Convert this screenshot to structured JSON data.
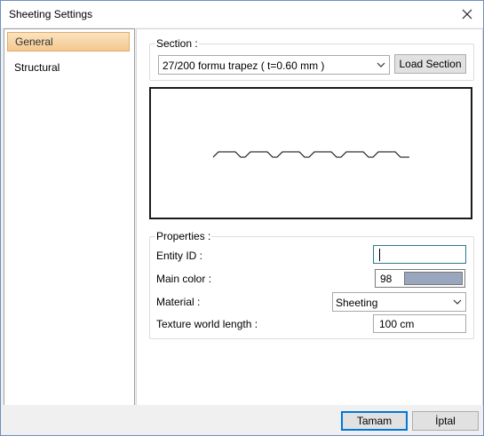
{
  "window": {
    "title": "Sheeting Settings"
  },
  "sidebar": {
    "items": [
      {
        "label": "General",
        "active": true
      },
      {
        "label": "Structural",
        "active": false
      }
    ]
  },
  "section": {
    "group_label": "Section :",
    "selected": "27/200 formu trapez ( t=0.60 mm )",
    "load_button": "Load Section"
  },
  "properties": {
    "group_label": "Properties :",
    "entity_id_label": "Entity ID :",
    "entity_id_value": "",
    "main_color_label": "Main color :",
    "main_color_value": "98",
    "main_color_swatch": "#9aa6bd",
    "material_label": "Material :",
    "material_value": "Sheeting",
    "texture_label": "Texture world length :",
    "texture_value": "100 cm"
  },
  "footer": {
    "ok_label": "Tamam",
    "cancel_label": "İptal"
  },
  "colors": {
    "active_nav_bg": "#f3c88e",
    "focus_border": "#2b7a8c",
    "primary_border": "#0078d7"
  },
  "icons": {
    "close": "close-icon",
    "dropdown": "chevron-down-icon"
  }
}
